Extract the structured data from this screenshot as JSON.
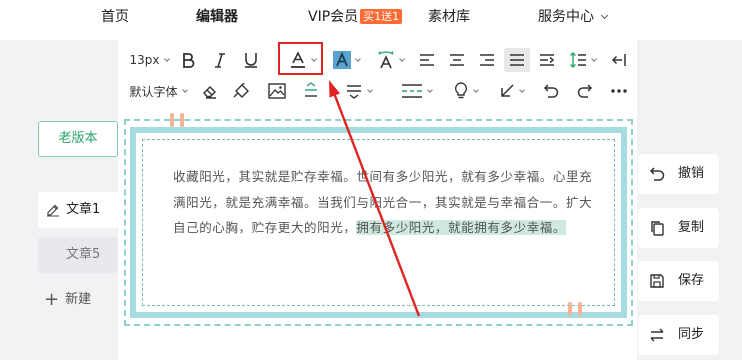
{
  "nav": {
    "items": [
      "首页",
      "编辑器",
      "VIP会员",
      "素材库",
      "服务中心"
    ],
    "vip_badge": "买1送1"
  },
  "left_panel": {
    "old_version_button": "老版本",
    "articles": [
      "文章1",
      "文章5"
    ],
    "new_label": "新建"
  },
  "toolbar": {
    "font_size": "13px",
    "font_family": "默认字体",
    "icons_row1": [
      "font-size-select",
      "bold",
      "italic",
      "underline",
      "font-color",
      "background-color",
      "text-effect",
      "align-left",
      "align-center",
      "align-right",
      "justify",
      "indent",
      "line-height",
      "exit"
    ],
    "icons_row2": [
      "font-family-select",
      "eraser",
      "format-painter",
      "image",
      "spacing-top",
      "spacing-bottom",
      "divider",
      "lightbulb",
      "arrow-down-left",
      "undo",
      "redo",
      "more"
    ]
  },
  "article": {
    "text_plain": "收藏阳光，其实就是贮存幸福。世间有多少阳光，就有多少幸福。心里充满阳光，就是充满幸福。当我们与阳光合一，其实就是与幸福合一。扩大自己的心胸，贮存更大的阳光，",
    "text_highlighted": "拥有多少阳光，就能拥有多少幸福。"
  },
  "actions": [
    "撤销",
    "复制",
    "保存",
    "同步"
  ],
  "colors": {
    "accent_green": "#2aa36b",
    "annotation_red": "#e02424",
    "frame_teal": "#a6dbe0",
    "badge_orange": "#ff6b35",
    "highlight_teal": "#cfe9e0"
  }
}
